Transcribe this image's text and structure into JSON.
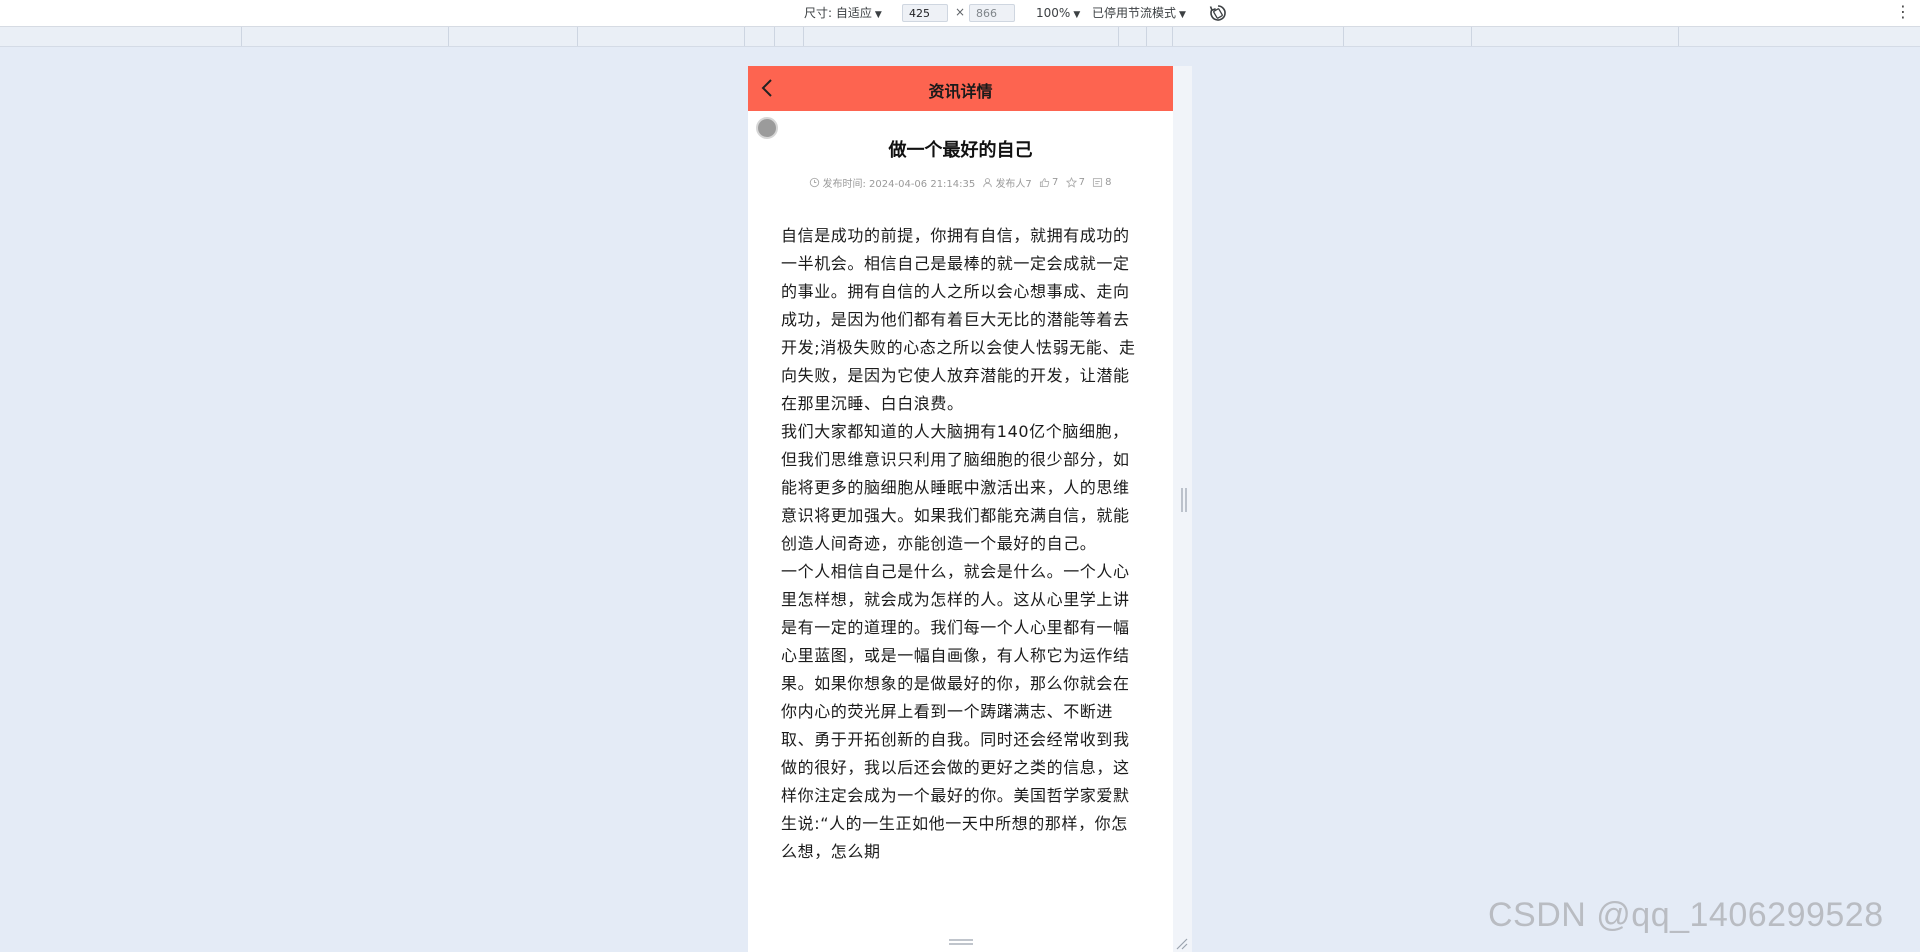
{
  "toolbar": {
    "dimensions_label": "尺寸: 自适应",
    "width_value": "425",
    "height_value": "866",
    "times_symbol": "×",
    "zoom_label": "100%",
    "throttle_label": "已停用节流模式"
  },
  "header": {
    "title": "资讯详情"
  },
  "article": {
    "title": "做一个最好的自己",
    "meta": {
      "publish_time": "发布时间: 2024-04-06 21:14:35",
      "publisher": "发布人7",
      "likes": "7",
      "favorites": "7",
      "views": "8"
    },
    "paragraphs": [
      "自信是成功的前提，你拥有自信，就拥有成功的一半机会。相信自己是最棒的就一定会成就一定的事业。拥有自信的人之所以会心想事成、走向成功，是因为他们都有着巨大无比的潜能等着去开发;消极失败的心态之所以会使人怯弱无能、走向失败，是因为它使人放弃潜能的开发，让潜能在那里沉睡、白白浪费。",
      "我们大家都知道的人大脑拥有140亿个脑细胞，但我们思维意识只利用了脑细胞的很少部分，如能将更多的脑细胞从睡眠中激活出来，人的思维意识将更加强大。如果我们都能充满自信，就能创造人间奇迹，亦能创造一个最好的自己。",
      "一个人相信自己是什么，就会是什么。一个人心里怎样想，就会成为怎样的人。这从心里学上讲是有一定的道理的。我们每一个人心里都有一幅心里蓝图，或是一幅自画像，有人称它为运作结果。如果你想象的是做最好的你，那么你就会在你内心的荧光屏上看到一个踌躇满志、不断进取、勇于开拓创新的自我。同时还会经常收到我做的很好，我以后还会做的更好之类的信息，这样你注定会成为一个最好的你。美国哲学家爱默生说:“人的一生正如他一天中所想的那样，你怎么想，怎么期"
    ]
  },
  "watermark": "CSDN @qq_1406299528",
  "colors": {
    "header_bg": "#fd6450",
    "page_bg": "#e4ebf6"
  }
}
